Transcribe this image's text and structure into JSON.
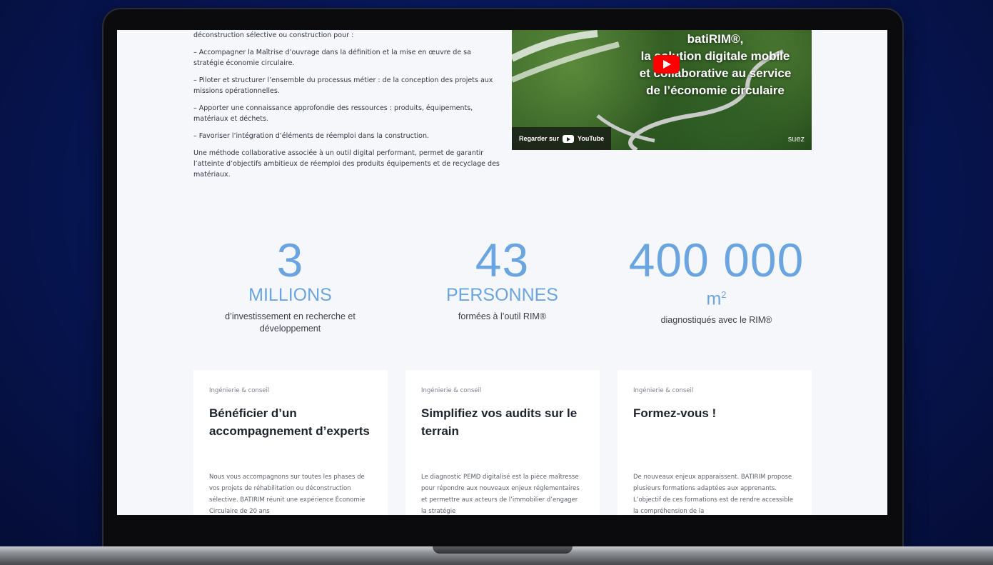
{
  "intro": {
    "lead": "déconstruction sélective ou construction pour :",
    "bullets": [
      "– Accompagner la Maîtrise d’ouvrage dans la définition et la mise en œuvre de sa stratégie économie circulaire.",
      "– Piloter et structurer l’ensemble du processus métier : de la conception des projets aux missions opérationnelles.",
      "– Apporter une connaissance approfondie des ressources : produits, équipements, matériaux et déchets.",
      "– Favoriser l’intégration d’éléments de réemploi dans la construction."
    ],
    "closing": "Une méthode collaborative associée à un outil digital performant, permet de garantir l’atteinte d’objectifs ambitieux de réemploi des produits équipements et de recyclage des matériaux."
  },
  "video": {
    "title_lines": [
      "batiRIM®,",
      "la solution digitale mobile",
      "et collaborative au service",
      "de l’économie circulaire"
    ],
    "watch_label": "Regarder sur",
    "platform": "YouTube",
    "brand": "suez",
    "play_icon": "play-icon",
    "accent_color": "#ff0000"
  },
  "stats": [
    {
      "number": "3",
      "unit": "MILLIONS",
      "desc": "d’investissement en recherche et développement"
    },
    {
      "number": "43",
      "unit": "PERSONNES",
      "desc": "formées à l’outil RIM®"
    },
    {
      "number": "400 000",
      "unit": "m",
      "unit_sup": "2",
      "desc": "diagnostiqués avec le RIM®"
    }
  ],
  "cards": [
    {
      "category": "Ingénierie & conseil",
      "title": "Bénéficier d’un accompagnement d’experts",
      "body": "Nous vous accompagnons sur toutes les phases de vos projets de réhabilitation ou déconstruction sélective. BATIRIM réunit une expérience Économie Circulaire de 20 ans"
    },
    {
      "category": "Ingénierie & conseil",
      "title": "Simplifiez vos audits sur le terrain",
      "body": "Le diagnostic PEMD digitalisé est la pièce maîtresse pour répondre aux nouveaux enjeux réglementaires et permettre aux acteurs de l’immobilier d’engager la stratégie"
    },
    {
      "category": "Ingénierie & conseil",
      "title": "Formez-vous !",
      "body": "De nouveaux enjeux apparaissent. BATIRIM propose plusieurs formations adaptées aux apprenants. L’objectif de ces formations est de rendre accessible la compréhension de la"
    }
  ],
  "colors": {
    "stat_blue": "#6aa5e2",
    "background": "#f6f7fb"
  }
}
